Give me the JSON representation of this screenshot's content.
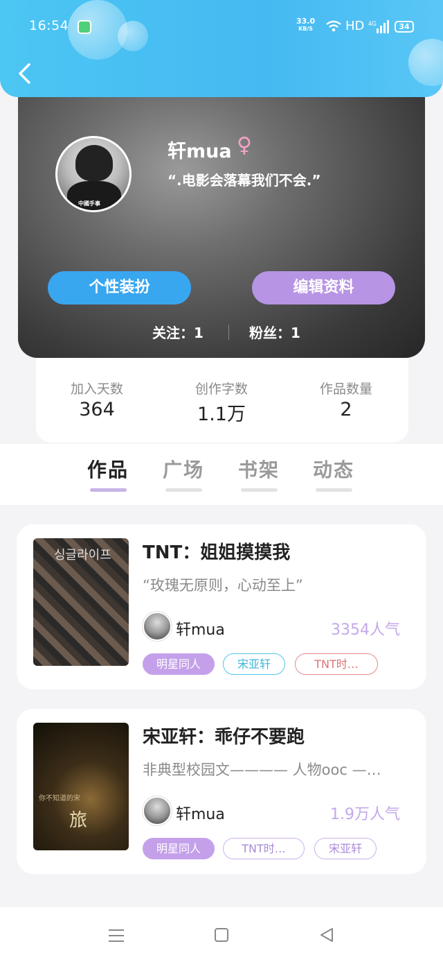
{
  "status": {
    "time": "16:54",
    "speed_value": "33.0",
    "speed_unit": "KB/S",
    "network": "HD",
    "cell": "4G",
    "battery": "34"
  },
  "profile": {
    "username": "轩mua",
    "gender_symbol": "♀",
    "motto": "“.电影会落幕我们不会.”",
    "avatar_caption": "中國手事",
    "btn_style": "个性装扮",
    "btn_edit": "编辑资料",
    "following": "关注：1",
    "followers": "粉丝：1"
  },
  "stats": [
    {
      "label": "加入天数",
      "value": "364"
    },
    {
      "label": "创作字数",
      "value": "1.1万"
    },
    {
      "label": "作品数量",
      "value": "2"
    }
  ],
  "tabs": [
    "作品",
    "广场",
    "书架",
    "动态"
  ],
  "works": [
    {
      "title": "TNT：姐姐摸摸我",
      "desc": "“玫瑰无原则，心动至上”",
      "author": "轩mua",
      "popularity": "3354人气",
      "cover_text": "싱글라이프",
      "tags": [
        "明星同人",
        "宋亚轩",
        "TNT时…"
      ]
    },
    {
      "title": "宋亚轩：乖仔不要跑",
      "desc": "非典型校园文———— 人物ooc —…",
      "author": "轩mua",
      "popularity": "1.9万人气",
      "cover_text": "旅",
      "cover_subtext": "你不知道的宋",
      "tags": [
        "明星同人",
        "TNT时…",
        "宋亚轩"
      ]
    }
  ]
}
